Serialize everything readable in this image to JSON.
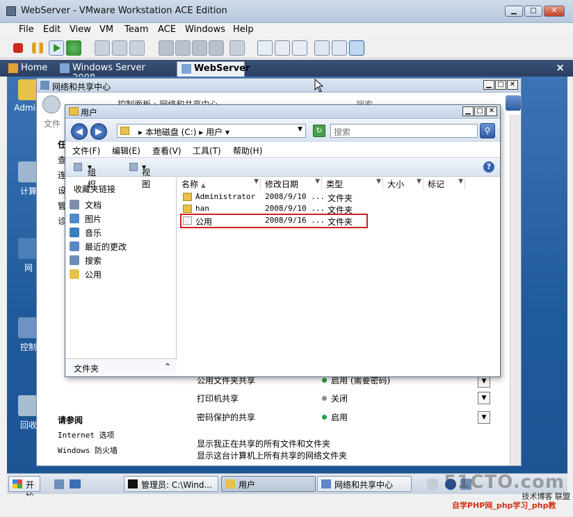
{
  "vm": {
    "title": "WebServer - VMware Workstation ACE Edition",
    "menu": [
      "File",
      "Edit",
      "View",
      "VM",
      "Team",
      "ACE",
      "Windows",
      "Help"
    ],
    "tabs": [
      {
        "label": "Home"
      },
      {
        "label": "Windows Server 2008"
      },
      {
        "label": "WebServer"
      }
    ],
    "caption_min": "▁",
    "caption_max": "□",
    "caption_close": "✕",
    "tab_close": "×"
  },
  "desktop": {
    "icons": [
      {
        "label": "Admini"
      },
      {
        "label": "计算"
      },
      {
        "label": "网"
      },
      {
        "label": "控制"
      },
      {
        "label": "回收"
      }
    ]
  },
  "nsc": {
    "title": "网络和共享中心",
    "address": "控制面板 › 网络和共享中心",
    "search_placeholder": "搜索",
    "left_fragment": "文件",
    "left_heading": "任",
    "left_chars": [
      "查",
      "连",
      "设",
      "管",
      "诊"
    ],
    "see_also": "请参阅",
    "links": [
      "Internet 选项",
      "Windows 防火墙"
    ],
    "rows": [
      {
        "label": "公用文件夹共享",
        "status": "启用 (需要密码)",
        "color": "#1fa33a"
      },
      {
        "label": "打印机共享",
        "status": "关闭",
        "color": "#8c8c8c"
      },
      {
        "label": "密码保护的共享",
        "status": "启用",
        "color": "#1fa33a"
      }
    ],
    "footer_links": [
      "显示我正在共享的所有文件和文件夹",
      "显示这台计算机上所有共享的网络文件夹"
    ]
  },
  "explorer": {
    "title": "用户",
    "address": [
      "本地磁盘 (C:)",
      "用户"
    ],
    "search_placeholder": "搜索",
    "menu": [
      "文件(F)",
      "编辑(E)",
      "查看(V)",
      "工具(T)",
      "帮助(H)"
    ],
    "organize": "组织",
    "views": "视图",
    "fav_heading": "收藏夹链接",
    "favorites": [
      {
        "label": "文档",
        "color": "#7b8fa8"
      },
      {
        "label": "图片",
        "color": "#4f8bc9"
      },
      {
        "label": "音乐",
        "color": "#3a7fc0"
      },
      {
        "label": "最近的更改",
        "color": "#5b86c8"
      },
      {
        "label": "搜索",
        "color": "#6d8fb8"
      },
      {
        "label": "公用",
        "color": "#e8c14a"
      }
    ],
    "folders_label": "文件夹",
    "columns": [
      "名称",
      "修改日期",
      "类型",
      "大小",
      "标记"
    ],
    "files": [
      {
        "name": "Administrator",
        "date": "2008/9/10 ...",
        "type": "文件夹"
      },
      {
        "name": "han",
        "date": "2008/9/10 ...",
        "type": "文件夹"
      },
      {
        "name": "公用",
        "date": "2008/9/16 ...",
        "type": "文件夹"
      }
    ]
  },
  "taskbar": {
    "start": "开始",
    "items": [
      "管理员: C:\\Wind...",
      "用户",
      "网络和共享中心"
    ]
  },
  "watermark": {
    "brand": "51CTO.com",
    "line2": "技术博客 联盟",
    "line3": "自学PHP网_php学习_php教"
  }
}
